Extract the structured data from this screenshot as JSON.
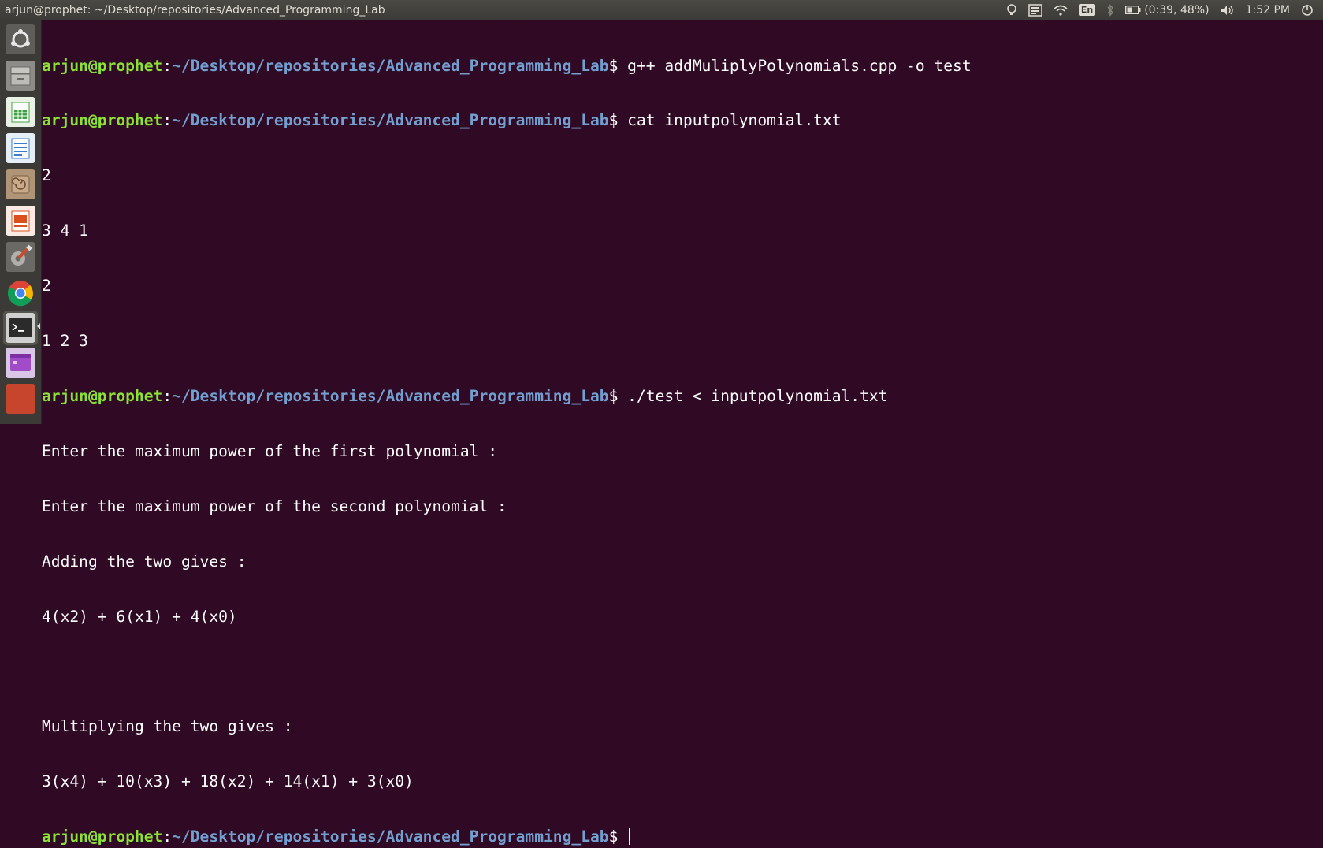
{
  "window": {
    "title": "arjun@prophet: ~/Desktop/repositories/Advanced_Programming_Lab"
  },
  "indicators": {
    "keyboard_layout": "En",
    "battery": "(0:39, 48%)",
    "time": "1:52 PM"
  },
  "launcher": {
    "items": [
      {
        "icon": "ubuntu-dash-icon",
        "color": "#7a7a7a"
      },
      {
        "icon": "files-icon",
        "color": "#9a9a9a"
      },
      {
        "icon": "libreoffice-calc-icon",
        "color": "#3fa142"
      },
      {
        "icon": "libreoffice-writer-icon",
        "color": "#3a7ecf"
      },
      {
        "icon": "archive-manager-icon",
        "color": "#a8876a"
      },
      {
        "icon": "libreoffice-impress-icon",
        "color": "#d9501c"
      },
      {
        "icon": "system-settings-icon",
        "color": "#cc4a2a"
      },
      {
        "icon": "chrome-icon",
        "color": "#db4437"
      },
      {
        "icon": "terminal-icon",
        "color": "#2b2b2b"
      },
      {
        "icon": "app-icon",
        "color": "#a04cc6"
      }
    ]
  },
  "terminal": {
    "user_host": "arjun@prophet",
    "prompt_path": "~/Desktop/repositories/Advanced_Programming_Lab",
    "prompt_symbol": "$",
    "commands": [
      " g++ addMuliplyPolynomials.cpp -o test",
      " cat inputpolynomial.txt",
      " ./test < inputpolynomial.txt"
    ],
    "cat_output": [
      "2",
      "3 4 1",
      "2",
      "1 2 3"
    ],
    "program_output": [
      "Enter the maximum power of the first polynomial :",
      "Enter the maximum power of the second polynomial :",
      "Adding the two gives :",
      "4(x2) + 6(x1) + 4(x0)",
      "",
      "Multiplying the two gives :",
      "3(x4) + 10(x3) + 18(x2) + 14(x1) + 3(x0)"
    ],
    "colors": {
      "background": "#300a24",
      "user_host": "#8ae234",
      "path": "#729fcf",
      "text": "#ffffff"
    }
  }
}
